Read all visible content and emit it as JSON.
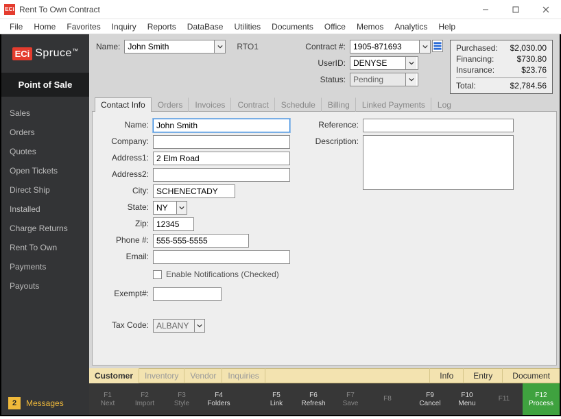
{
  "window": {
    "title": "Rent To Own Contract",
    "app_icon_text": "ECi"
  },
  "menu": [
    "File",
    "Home",
    "Favorites",
    "Inquiry",
    "Reports",
    "DataBase",
    "Utilities",
    "Documents",
    "Office",
    "Memos",
    "Analytics",
    "Help"
  ],
  "brand": {
    "eci": "ECi",
    "spruce": "Spruce",
    "tm": "™"
  },
  "sidebar": {
    "section_title": "Point of Sale",
    "items": [
      "Sales",
      "Orders",
      "Quotes",
      "Open Tickets",
      "Direct Ship",
      "Installed",
      "Charge Returns",
      "Rent To Own",
      "Payments",
      "Payouts"
    ],
    "messages_count": "2",
    "messages_label": "Messages"
  },
  "header": {
    "name_label": "Name:",
    "name_value": "John Smith",
    "code": "RTO1",
    "contract_label": "Contract #:",
    "contract_value": "1905-871693",
    "userid_label": "UserID:",
    "userid_value": "DENYSE",
    "status_label": "Status:",
    "status_value": "Pending"
  },
  "totals": {
    "purchased_label": "Purchased:",
    "purchased_value": "$2,030.00",
    "financing_label": "Financing:",
    "financing_value": "$730.80",
    "insurance_label": "Insurance:",
    "insurance_value": "$23.76",
    "total_label": "Total:",
    "total_value": "$2,784.56"
  },
  "tabs": [
    "Contact Info",
    "Orders",
    "Invoices",
    "Contract",
    "Schedule",
    "Billing",
    "Linked Payments",
    "Log"
  ],
  "form": {
    "labels": {
      "name": "Name:",
      "company": "Company:",
      "address1": "Address1:",
      "address2": "Address2:",
      "city": "City:",
      "state": "State:",
      "zip": "Zip:",
      "phone": "Phone #:",
      "email": "Email:",
      "enable_notifications": "Enable Notifications (Checked)",
      "exempt": "Exempt#:",
      "taxcode": "Tax Code:",
      "reference": "Reference:",
      "description": "Description:"
    },
    "values": {
      "name": "John Smith",
      "company": "",
      "address1": "2 Elm Road",
      "address2": "",
      "city": "SCHENECTADY",
      "state": "NY",
      "zip": "12345",
      "phone": "555-555-5555",
      "email": "",
      "exempt": "",
      "taxcode": "ALBANY",
      "reference": "",
      "description": ""
    }
  },
  "goldbar": {
    "tabs": [
      "Customer",
      "Inventory",
      "Vendor",
      "Inquiries"
    ],
    "links": [
      "Info",
      "Entry",
      "Document"
    ]
  },
  "fkeys": [
    {
      "key": "F1",
      "label": "Next",
      "enabled": false
    },
    {
      "key": "F2",
      "label": "Import",
      "enabled": false
    },
    {
      "key": "F3",
      "label": "Style",
      "enabled": false
    },
    {
      "key": "F4",
      "label": "Folders",
      "enabled": true
    },
    {
      "key": "F5",
      "label": "Link",
      "enabled": true
    },
    {
      "key": "F6",
      "label": "Refresh",
      "enabled": true
    },
    {
      "key": "F7",
      "label": "Save",
      "enabled": false
    },
    {
      "key": "F8",
      "label": "",
      "enabled": false
    },
    {
      "key": "F9",
      "label": "Cancel",
      "enabled": true
    },
    {
      "key": "F10",
      "label": "Menu",
      "enabled": true
    },
    {
      "key": "F11",
      "label": "",
      "enabled": false
    },
    {
      "key": "F12",
      "label": "Process",
      "enabled": true,
      "process": true
    }
  ]
}
